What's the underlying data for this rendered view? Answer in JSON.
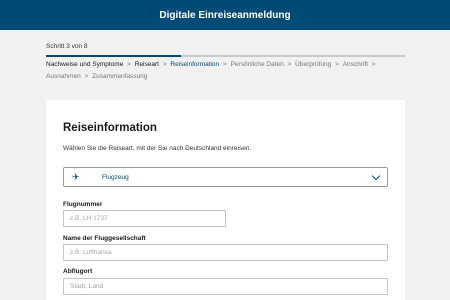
{
  "header": {
    "title": "Digitale Einreiseanmeldung"
  },
  "progress": {
    "label": "Schritt 3 von 8",
    "fraction": 0.375,
    "steps": [
      {
        "label": "Nachweise und Symptome",
        "state": "done"
      },
      {
        "label": "Reiseart",
        "state": "done"
      },
      {
        "label": "Reiseinformation",
        "state": "current"
      },
      {
        "label": "Persönliche Daten",
        "state": "upcoming"
      },
      {
        "label": "Überprüfung",
        "state": "upcoming"
      },
      {
        "label": "Anschrift",
        "state": "upcoming"
      },
      {
        "label": "Ausnahmen",
        "state": "upcoming"
      },
      {
        "label": "Zusammenfassung",
        "state": "upcoming"
      }
    ],
    "separator": ">"
  },
  "form": {
    "title": "Reiseinformation",
    "intro": "Wählen Sie die Reiseart, mit der Sie nach Deutschland einreisen.",
    "travel_mode": {
      "value": "Flugzeug",
      "icon": "airplane-icon"
    },
    "flight_number": {
      "label": "Flugnummer",
      "placeholder": "z.B. LH 1737",
      "value": ""
    },
    "airline": {
      "label": "Name der Fluggesellschaft",
      "placeholder": "z.B. Lufthansa",
      "value": ""
    },
    "departure": {
      "label": "Abflugort",
      "placeholder": "Stadt, Land",
      "value": ""
    }
  },
  "colors": {
    "brand": "#004b76",
    "background": "#f1f1f1",
    "card": "#ffffff"
  }
}
